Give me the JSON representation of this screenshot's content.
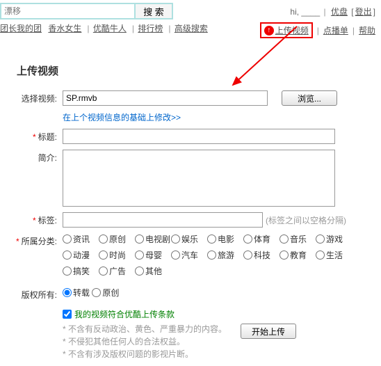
{
  "search": {
    "placeholder": "漂移",
    "button": "搜 索"
  },
  "user": {
    "greeting": "hi,",
    "name": "____",
    "youpan": "优盘",
    "logout": "登出"
  },
  "nav": [
    "团长我的团",
    "香水女生",
    "优酷牛人",
    "排行榜",
    "高级搜索"
  ],
  "right": {
    "upload": "上传视频",
    "dianbo": "点播单",
    "help": "帮助"
  },
  "title": "上传视频",
  "form": {
    "file_label": "选择视频:",
    "file_value": "SP.rmvb",
    "browse": "浏览...",
    "modify_link": "在上个视频信息的基础上修改>>",
    "title_label": "标题:",
    "desc_label": "简介:",
    "tags_label": "标签:",
    "tags_hint": "(标签之间以空格分隔)",
    "cat_label": "所属分类:",
    "cats_a": [
      "资讯",
      "原创",
      "电视剧",
      "娱乐",
      "电影",
      "体育",
      "音乐",
      "游戏"
    ],
    "cats_b": [
      "动漫",
      "时尚",
      "母婴",
      "汽车",
      "旅游",
      "科技",
      "教育",
      "生活"
    ],
    "cats_c": [
      "搞笑",
      "广告",
      "其他"
    ],
    "copyright_label": "版权所有:",
    "cp1": "转载",
    "cp2": "原创",
    "agree": "我的视频符合优酷上传条款",
    "n1": "不含有反动政治、黄色、严重暴力的内容。",
    "n2": "不侵犯其他任何人的合法权益。",
    "n3": "不含有涉及版权问题的影视片断。",
    "start": "开始上传"
  }
}
